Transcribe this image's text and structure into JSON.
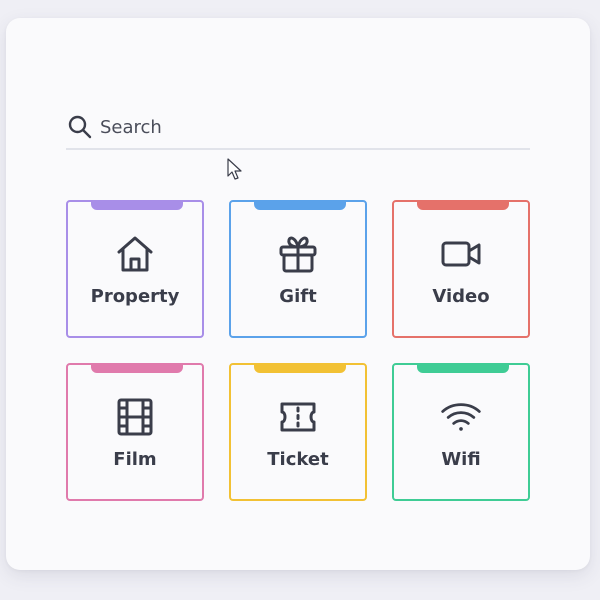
{
  "search": {
    "placeholder": "Search",
    "value": ""
  },
  "tiles": [
    {
      "label": "Property",
      "icon": "home-icon",
      "color": "#a88ee8"
    },
    {
      "label": "Gift",
      "icon": "gift-icon",
      "color": "#5ba2ea"
    },
    {
      "label": "Video",
      "icon": "video-camera-icon",
      "color": "#e5716a"
    },
    {
      "label": "Film",
      "icon": "film-icon",
      "color": "#e07aac"
    },
    {
      "label": "Ticket",
      "icon": "ticket-icon",
      "color": "#f2c134"
    },
    {
      "label": "Wifi",
      "icon": "wifi-icon",
      "color": "#3fcc95"
    }
  ],
  "colors": {
    "icon": "#3a3d4a",
    "divider": "#e1e3ea",
    "card": "#fafafc",
    "background": "#efeff5"
  }
}
